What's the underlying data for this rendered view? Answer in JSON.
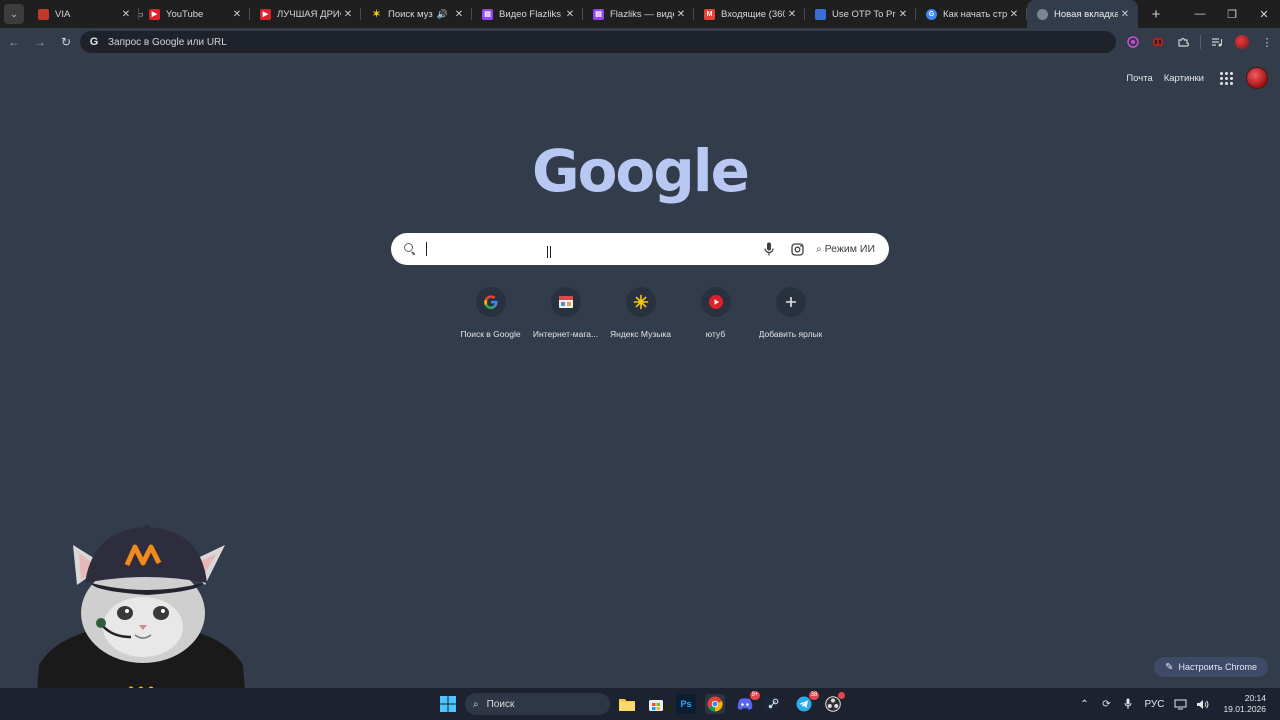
{
  "tabs": [
    {
      "title": "VIA",
      "favicon": "via-flag-icon",
      "active": false
    },
    {
      "title": "YouTube",
      "favicon": "youtube-icon",
      "active": false
    },
    {
      "title": "ЛУЧШАЯ ДРИФТ",
      "favicon": "youtube-icon",
      "active": false
    },
    {
      "title": "Поиск музык",
      "favicon": "yandex-music-icon",
      "active": false,
      "audio": true
    },
    {
      "title": "Видео Flazliks - T",
      "favicon": "twitch-icon",
      "active": false
    },
    {
      "title": "Flazliks — видеос",
      "favicon": "twitch-icon",
      "active": false
    },
    {
      "title": "Входящие (360) -",
      "favicon": "gmail-icon",
      "active": false
    },
    {
      "title": "Use OTP To Proce",
      "favicon": "otp-site-icon",
      "active": false
    },
    {
      "title": "Как начать стри",
      "favicon": "google-icon",
      "active": false
    },
    {
      "title": "Новая вкладка",
      "favicon": "chrome-icon",
      "active": true
    }
  ],
  "omnibox": {
    "placeholder": "Запрос в Google или URL"
  },
  "top_links": {
    "mail": "Почта",
    "images": "Картинки"
  },
  "logo_text": "Google",
  "search": {
    "value": "",
    "ai_mode_label": "Режим ИИ"
  },
  "shortcuts": [
    {
      "label": "Поиск в Google",
      "icon": "google-icon"
    },
    {
      "label": "Интернет-мага...",
      "icon": "store-icon"
    },
    {
      "label": "Яндекс Музыка",
      "icon": "yandex-music-icon"
    },
    {
      "label": "ютуб",
      "icon": "youtube-icon"
    },
    {
      "label": "Добавить ярлык",
      "icon": "plus-icon"
    }
  ],
  "customize_label": "Настроить Chrome",
  "taskbar": {
    "search_placeholder": "Поиск",
    "language": "РУС",
    "time": "20:14",
    "date": "19.01.2026",
    "discord_badge": "9+",
    "telegram_badge": "38"
  },
  "colors": {
    "background": "#333c4b",
    "tabbar": "#1f1f1f",
    "logo": "#b9c8f2",
    "taskbar": "#1c2230"
  }
}
